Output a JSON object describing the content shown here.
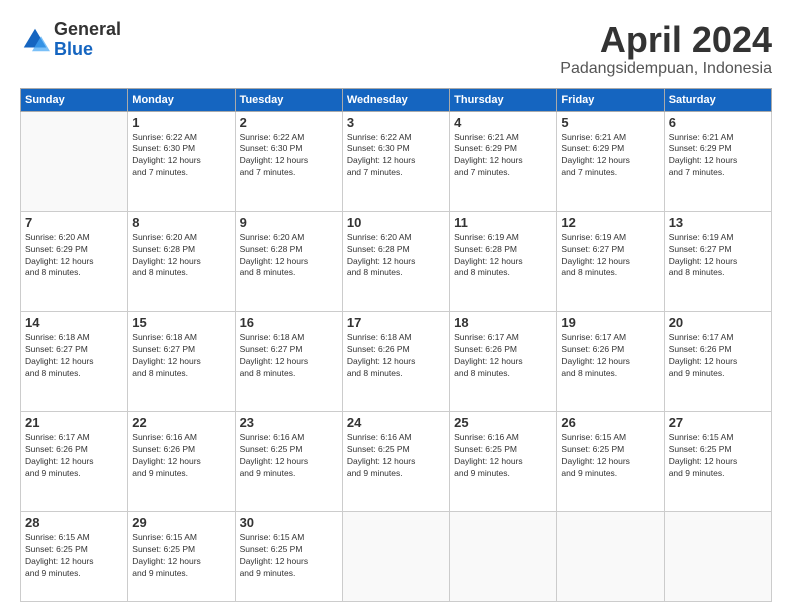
{
  "logo": {
    "general": "General",
    "blue": "Blue"
  },
  "header": {
    "month": "April 2024",
    "location": "Padangsidempuan, Indonesia"
  },
  "weekdays": [
    "Sunday",
    "Monday",
    "Tuesday",
    "Wednesday",
    "Thursday",
    "Friday",
    "Saturday"
  ],
  "weeks": [
    [
      {
        "day": "",
        "info": ""
      },
      {
        "day": "1",
        "info": "Sunrise: 6:22 AM\nSunset: 6:30 PM\nDaylight: 12 hours\nand 7 minutes."
      },
      {
        "day": "2",
        "info": "Sunrise: 6:22 AM\nSunset: 6:30 PM\nDaylight: 12 hours\nand 7 minutes."
      },
      {
        "day": "3",
        "info": "Sunrise: 6:22 AM\nSunset: 6:30 PM\nDaylight: 12 hours\nand 7 minutes."
      },
      {
        "day": "4",
        "info": "Sunrise: 6:21 AM\nSunset: 6:29 PM\nDaylight: 12 hours\nand 7 minutes."
      },
      {
        "day": "5",
        "info": "Sunrise: 6:21 AM\nSunset: 6:29 PM\nDaylight: 12 hours\nand 7 minutes."
      },
      {
        "day": "6",
        "info": "Sunrise: 6:21 AM\nSunset: 6:29 PM\nDaylight: 12 hours\nand 7 minutes."
      }
    ],
    [
      {
        "day": "7",
        "info": "Sunrise: 6:20 AM\nSunset: 6:29 PM\nDaylight: 12 hours\nand 8 minutes."
      },
      {
        "day": "8",
        "info": "Sunrise: 6:20 AM\nSunset: 6:28 PM\nDaylight: 12 hours\nand 8 minutes."
      },
      {
        "day": "9",
        "info": "Sunrise: 6:20 AM\nSunset: 6:28 PM\nDaylight: 12 hours\nand 8 minutes."
      },
      {
        "day": "10",
        "info": "Sunrise: 6:20 AM\nSunset: 6:28 PM\nDaylight: 12 hours\nand 8 minutes."
      },
      {
        "day": "11",
        "info": "Sunrise: 6:19 AM\nSunset: 6:28 PM\nDaylight: 12 hours\nand 8 minutes."
      },
      {
        "day": "12",
        "info": "Sunrise: 6:19 AM\nSunset: 6:27 PM\nDaylight: 12 hours\nand 8 minutes."
      },
      {
        "day": "13",
        "info": "Sunrise: 6:19 AM\nSunset: 6:27 PM\nDaylight: 12 hours\nand 8 minutes."
      }
    ],
    [
      {
        "day": "14",
        "info": "Sunrise: 6:18 AM\nSunset: 6:27 PM\nDaylight: 12 hours\nand 8 minutes."
      },
      {
        "day": "15",
        "info": "Sunrise: 6:18 AM\nSunset: 6:27 PM\nDaylight: 12 hours\nand 8 minutes."
      },
      {
        "day": "16",
        "info": "Sunrise: 6:18 AM\nSunset: 6:27 PM\nDaylight: 12 hours\nand 8 minutes."
      },
      {
        "day": "17",
        "info": "Sunrise: 6:18 AM\nSunset: 6:26 PM\nDaylight: 12 hours\nand 8 minutes."
      },
      {
        "day": "18",
        "info": "Sunrise: 6:17 AM\nSunset: 6:26 PM\nDaylight: 12 hours\nand 8 minutes."
      },
      {
        "day": "19",
        "info": "Sunrise: 6:17 AM\nSunset: 6:26 PM\nDaylight: 12 hours\nand 8 minutes."
      },
      {
        "day": "20",
        "info": "Sunrise: 6:17 AM\nSunset: 6:26 PM\nDaylight: 12 hours\nand 9 minutes."
      }
    ],
    [
      {
        "day": "21",
        "info": "Sunrise: 6:17 AM\nSunset: 6:26 PM\nDaylight: 12 hours\nand 9 minutes."
      },
      {
        "day": "22",
        "info": "Sunrise: 6:16 AM\nSunset: 6:26 PM\nDaylight: 12 hours\nand 9 minutes."
      },
      {
        "day": "23",
        "info": "Sunrise: 6:16 AM\nSunset: 6:25 PM\nDaylight: 12 hours\nand 9 minutes."
      },
      {
        "day": "24",
        "info": "Sunrise: 6:16 AM\nSunset: 6:25 PM\nDaylight: 12 hours\nand 9 minutes."
      },
      {
        "day": "25",
        "info": "Sunrise: 6:16 AM\nSunset: 6:25 PM\nDaylight: 12 hours\nand 9 minutes."
      },
      {
        "day": "26",
        "info": "Sunrise: 6:15 AM\nSunset: 6:25 PM\nDaylight: 12 hours\nand 9 minutes."
      },
      {
        "day": "27",
        "info": "Sunrise: 6:15 AM\nSunset: 6:25 PM\nDaylight: 12 hours\nand 9 minutes."
      }
    ],
    [
      {
        "day": "28",
        "info": "Sunrise: 6:15 AM\nSunset: 6:25 PM\nDaylight: 12 hours\nand 9 minutes."
      },
      {
        "day": "29",
        "info": "Sunrise: 6:15 AM\nSunset: 6:25 PM\nDaylight: 12 hours\nand 9 minutes."
      },
      {
        "day": "30",
        "info": "Sunrise: 6:15 AM\nSunset: 6:25 PM\nDaylight: 12 hours\nand 9 minutes."
      },
      {
        "day": "",
        "info": ""
      },
      {
        "day": "",
        "info": ""
      },
      {
        "day": "",
        "info": ""
      },
      {
        "day": "",
        "info": ""
      }
    ]
  ]
}
